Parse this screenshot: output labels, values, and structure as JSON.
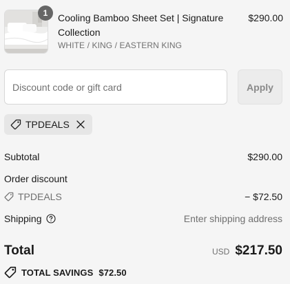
{
  "line_item": {
    "quantity": "1",
    "title": "Cooling Bamboo Sheet Set | Signature Collection",
    "variant": "WHITE / KING / EASTERN KING",
    "price": "$290.00",
    "image_icon": "bedding-product-image"
  },
  "discount": {
    "placeholder": "Discount code or gift card",
    "value": "",
    "apply_label": "Apply",
    "applied_code": "TPDEALS",
    "chip_icon": "tag-icon",
    "remove_icon": "close-icon"
  },
  "summary": {
    "subtotal_label": "Subtotal",
    "subtotal_value": "$290.00",
    "order_discount_label": "Order discount",
    "discount_code": "TPDEALS",
    "discount_value": "− $72.50",
    "shipping_label": "Shipping",
    "shipping_info_icon": "help-circle-icon",
    "shipping_value": "Enter shipping address"
  },
  "total": {
    "label": "Total",
    "currency": "USD",
    "amount": "$217.50",
    "savings_label": "TOTAL SAVINGS",
    "savings_amount": "$72.50",
    "savings_icon": "tag-icon"
  },
  "colors": {
    "background": "#f5f5f5",
    "text": "#1a1a1a",
    "muted": "#707070",
    "badge": "#666666",
    "chip": "#e6e6e6"
  }
}
